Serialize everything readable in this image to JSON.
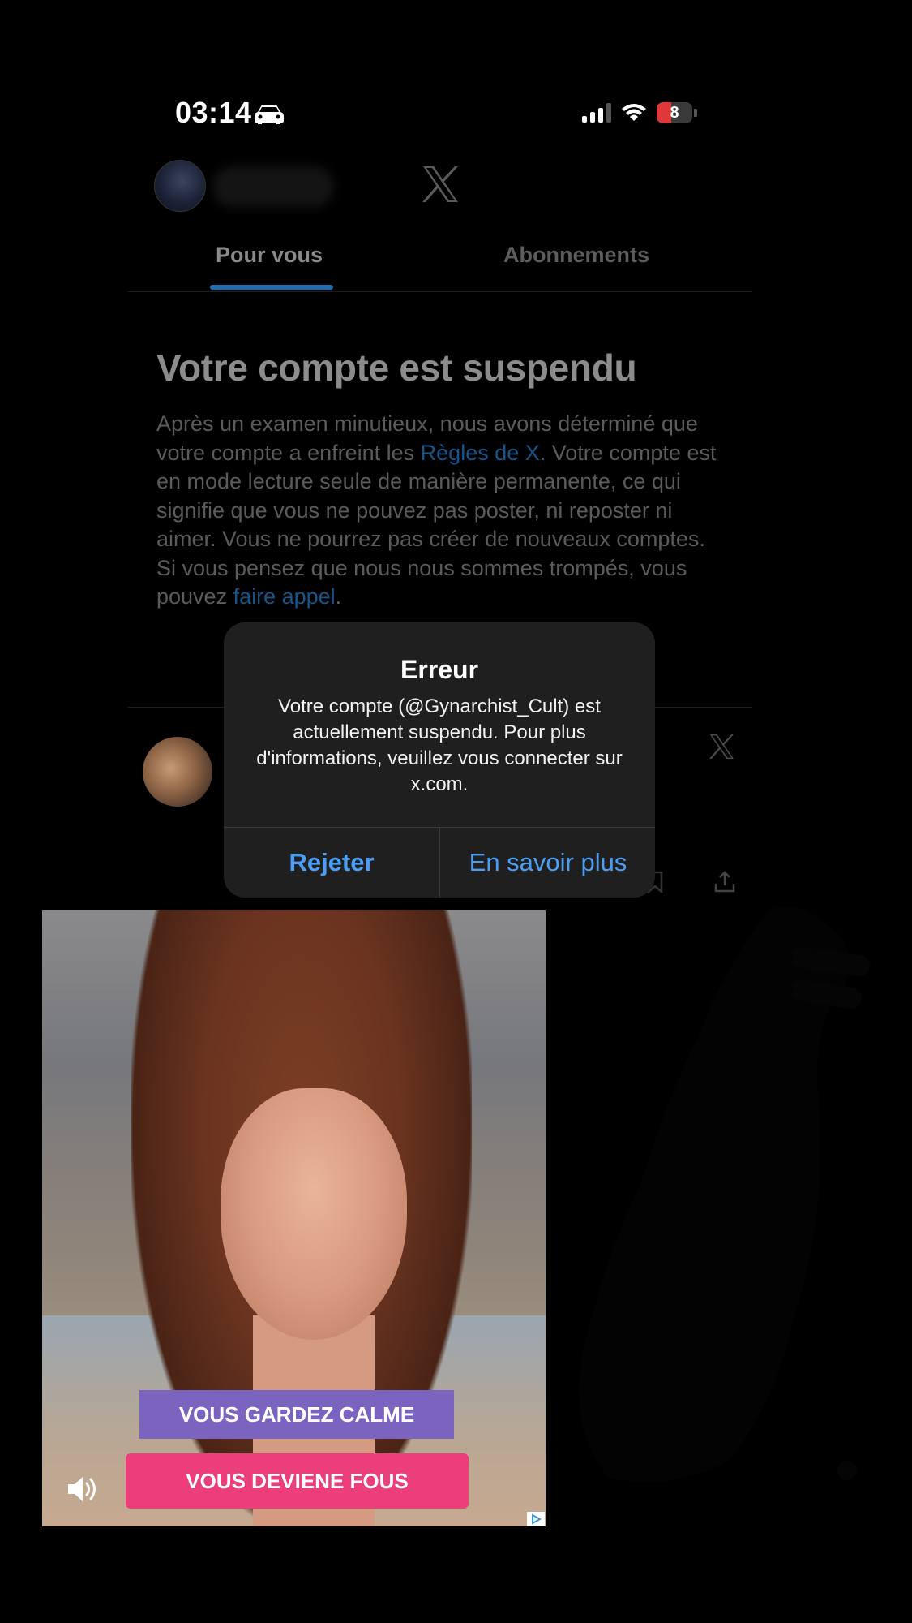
{
  "status_bar": {
    "time": "03:14",
    "battery": "8",
    "icons": [
      "car-icon",
      "signal-icon",
      "wifi-icon",
      "battery-icon"
    ]
  },
  "header": {
    "logo": "x-logo-icon"
  },
  "tabs": [
    {
      "label": "Pour vous",
      "active": true
    },
    {
      "label": "Abonnements",
      "active": false
    }
  ],
  "suspension": {
    "title": "Votre compte est suspendu",
    "body_part1": "Après un examen minutieux, nous avons déterminé que votre compte a enfreint les ",
    "link_rules": "Règles de X",
    "body_part2": ". Votre compte est en mode lecture seule de manière permanente, ce qui signifie que vous ne pouvez pas poster, ni reposter ni aimer. Vous ne pourrez pas créer de nouveaux comptes. Si vous pensez que nous nous sommes trompés, vous pouvez ",
    "link_appeal": "faire appel",
    "body_part3": "."
  },
  "alert": {
    "title": "Erreur",
    "message": "Votre compte (@Gynarchist_Cult) est actuellement suspendu. Pour plus d'informations, veuillez vous connecter sur x.com.",
    "button_reject": "Rejeter",
    "button_more": "En savoir plus"
  },
  "ad": {
    "banner_top": "VOUS GARDEZ CALME",
    "banner_bottom": "VOUS DEVIENE FOUS"
  },
  "colors": {
    "accent_blue": "#4c9ef5",
    "tab_underline": "#1d6bb0",
    "link_dim": "#17548a",
    "battery_red": "#e0373a",
    "ad_banner_purple": "#7b63c0",
    "ad_banner_pink": "#ec3e7a"
  }
}
